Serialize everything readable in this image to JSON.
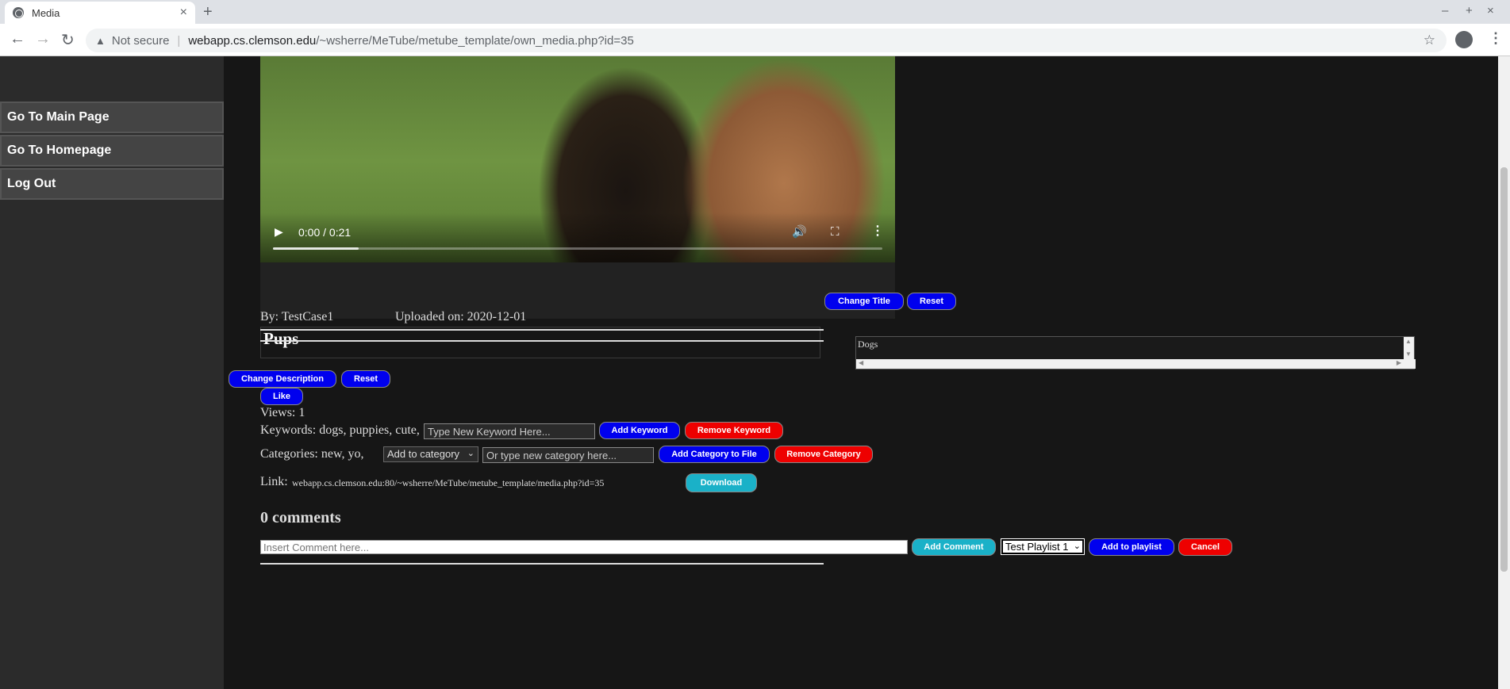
{
  "browser": {
    "tab_title": "Media",
    "tab_close": "×",
    "new_tab": "+",
    "win_min": "–",
    "win_max": "+",
    "win_close": "×",
    "back": "←",
    "forward": "→",
    "reload": "↻",
    "security_label": "Not secure",
    "url_host": "webapp.cs.clemson.edu",
    "url_path": "/~wsherre/MeTube/metube_template/own_media.php?id=35"
  },
  "sidebar": {
    "items": [
      {
        "label": "Go To Main Page"
      },
      {
        "label": "Go To Homepage"
      },
      {
        "label": "Log Out"
      }
    ]
  },
  "video": {
    "time": "0:00 / 0:21",
    "progress_fraction": 0.14
  },
  "media": {
    "title": "Pups",
    "author": "By: TestCase1",
    "uploaded": "Uploaded on: 2020-12-01",
    "description_value": "Dogs",
    "views": "Views: 1",
    "keywords": "Keywords: dogs, puppies, cute,",
    "categories": "Categories: new, yo,",
    "link_label": "Link:",
    "link_url": "webapp.cs.clemson.edu:80/~wsherre/MeTube/metube_template/media.php?id=35",
    "comments_count": "0 comments"
  },
  "buttons": {
    "change_title": "Change Title",
    "reset_title": "Reset",
    "change_description": "Change Description",
    "reset_description": "Reset",
    "like": "Like",
    "add_keyword": "Add Keyword",
    "remove_keyword": "Remove Keyword",
    "add_category": "Add Category to File",
    "remove_category": "Remove Category",
    "download": "Download",
    "add_comment": "Add Comment",
    "add_to_playlist": "Add to playlist",
    "cancel": "Cancel"
  },
  "inputs": {
    "keyword_value": "Type New Keyword Here...",
    "category_select": "Add to category",
    "category_value": "Or type new category here...",
    "comment_placeholder": "Insert Comment here...",
    "playlist_select": "Test Playlist 1"
  },
  "colors": {
    "blue_button": "#0000ee",
    "red_button": "#ee0000",
    "cyan_button": "#1ab1c8",
    "page_background": "#161616",
    "sidebar_background": "#2b2b2b"
  }
}
